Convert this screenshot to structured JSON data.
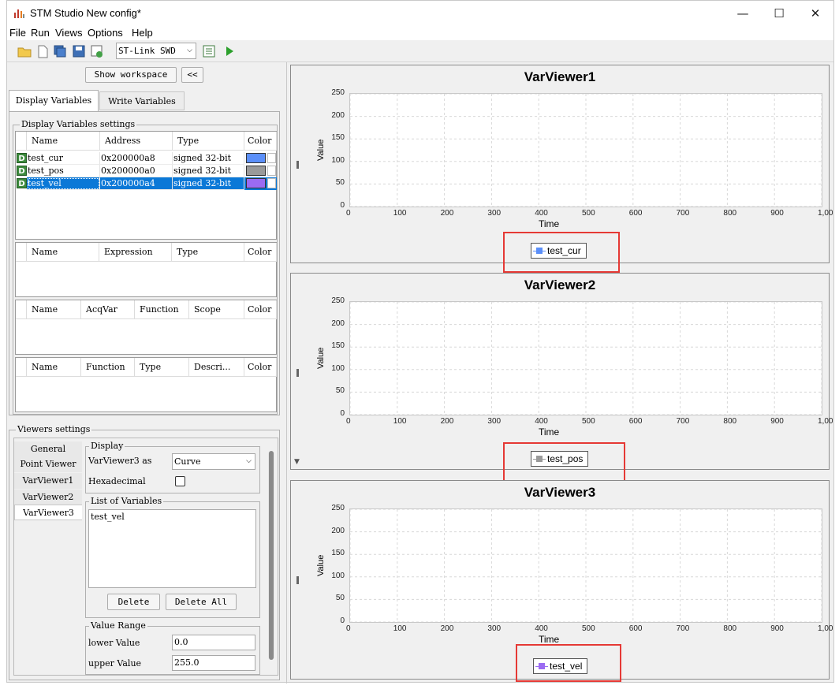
{
  "window": {
    "title": "STM Studio New config*",
    "controls": {
      "minimize": "—",
      "maximize": "☐",
      "close": "✕"
    }
  },
  "menu": [
    "File",
    "Run",
    "Views",
    "Options",
    "Help"
  ],
  "toolbar": {
    "connection_select": "ST-Link SWD",
    "icons": [
      "open-folder-icon",
      "new-file-icon",
      "save-all-icon",
      "save-icon",
      "export-icon",
      "settings-icon",
      "run-icon"
    ]
  },
  "left": {
    "show_workspace": "Show workspace",
    "collapse": "<<",
    "tabs": [
      "Display Variables",
      "Write Variables"
    ],
    "display_settings_title": "Display Variables settings",
    "var_table": {
      "headers": [
        "Name",
        "Address",
        "Type",
        "Color"
      ],
      "rows": [
        {
          "badge": "D",
          "name": "test_cur",
          "address": "0x200000a8",
          "type": "signed 32-bit",
          "color": "#5b8ff9"
        },
        {
          "badge": "D",
          "name": "test_pos",
          "address": "0x200000a0",
          "type": "signed 32-bit",
          "color": "#9a9a9a"
        },
        {
          "badge": "D",
          "name": "test_vel",
          "address": "0x200000a4",
          "type": "signed 32-bit",
          "color": "#9b6bf2"
        }
      ]
    },
    "expr_table": {
      "headers": [
        "Name",
        "Expression",
        "Type",
        "Color"
      ]
    },
    "acq_table": {
      "headers": [
        "Name",
        "AcqVar",
        "Function",
        "Scope",
        "Color"
      ]
    },
    "func_table": {
      "headers": [
        "Name",
        "Function",
        "Type",
        "Descri...",
        "Color"
      ]
    }
  },
  "viewers_settings": {
    "title": "Viewers settings",
    "tabs": [
      "General",
      "Point Viewer",
      "VarViewer1",
      "VarViewer2",
      "VarViewer3"
    ],
    "display_title": "Display",
    "as_label": "VarViewer3 as",
    "as_value": "Curve",
    "hex_label": "Hexadecimal",
    "list_title": "List of Variables",
    "list_items": [
      "test_vel"
    ],
    "delete": "Delete",
    "delete_all": "Delete All",
    "range_title": "Value Range",
    "lower_label": "lower Value",
    "lower_value": "0.0",
    "upper_label": "upper Value",
    "upper_value": "255.0"
  },
  "chart_data": [
    {
      "type": "line",
      "title": "VarViewer1",
      "xlabel": "Time",
      "ylabel": "Value",
      "xlim": [
        0,
        1000
      ],
      "ylim": [
        0,
        250
      ],
      "x_ticks": [
        "0",
        "100",
        "200",
        "300",
        "400",
        "500",
        "600",
        "700",
        "800",
        "900",
        "1,00"
      ],
      "y_ticks": [
        "250",
        "200",
        "150",
        "100",
        "50",
        "0"
      ],
      "grid": true,
      "legend_position": "bottom-center",
      "series": [
        {
          "name": "test_cur",
          "color": "#5b8ff9",
          "values": []
        }
      ]
    },
    {
      "type": "line",
      "title": "VarViewer2",
      "xlabel": "Time",
      "ylabel": "Value",
      "xlim": [
        0,
        1000
      ],
      "ylim": [
        0,
        250
      ],
      "x_ticks": [
        "0",
        "100",
        "200",
        "300",
        "400",
        "500",
        "600",
        "700",
        "800",
        "900",
        "1,00"
      ],
      "y_ticks": [
        "250",
        "200",
        "150",
        "100",
        "50",
        "0"
      ],
      "grid": true,
      "legend_position": "bottom-center",
      "series": [
        {
          "name": "test_pos",
          "color": "#9a9a9a",
          "values": []
        }
      ]
    },
    {
      "type": "line",
      "title": "VarViewer3",
      "xlabel": "Time",
      "ylabel": "Value",
      "xlim": [
        0,
        1000
      ],
      "ylim": [
        0,
        250
      ],
      "x_ticks": [
        "0",
        "100",
        "200",
        "300",
        "400",
        "500",
        "600",
        "700",
        "800",
        "900",
        "1,00"
      ],
      "y_ticks": [
        "250",
        "200",
        "150",
        "100",
        "50",
        "0"
      ],
      "grid": true,
      "legend_position": "bottom-center",
      "series": [
        {
          "name": "test_vel",
          "color": "#9b6bf2",
          "values": []
        }
      ]
    }
  ]
}
